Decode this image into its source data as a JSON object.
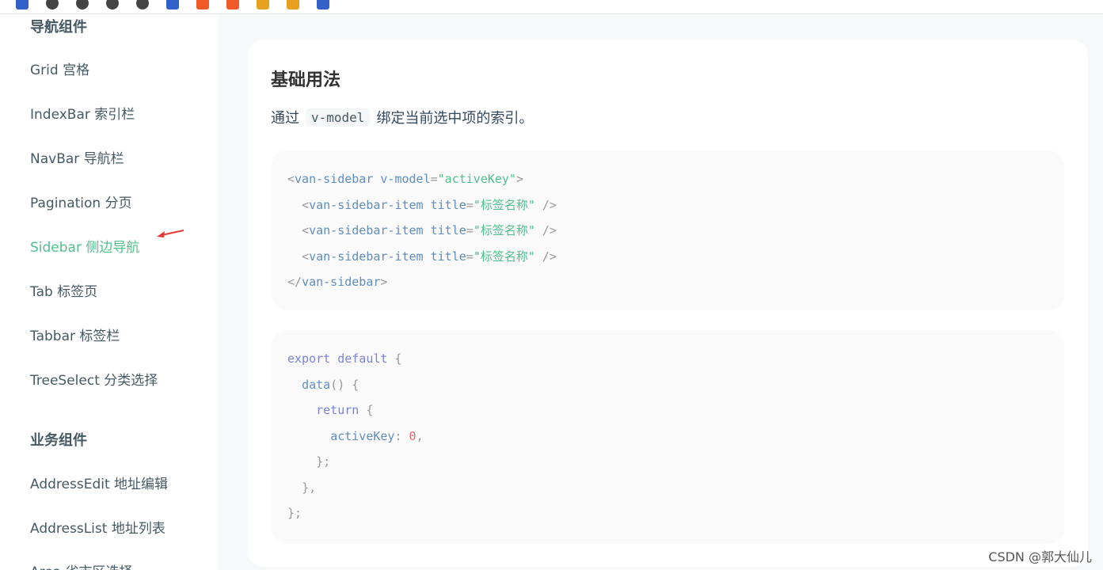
{
  "sidebar": {
    "groups": [
      {
        "title": "导航组件"
      },
      {
        "title": "业务组件"
      }
    ],
    "nav_items": [
      {
        "label": "Grid 宫格"
      },
      {
        "label": "IndexBar 索引栏"
      },
      {
        "label": "NavBar 导航栏"
      },
      {
        "label": "Pagination 分页"
      },
      {
        "label": "Sidebar 侧边导航"
      },
      {
        "label": "Tab 标签页"
      },
      {
        "label": "Tabbar 标签栏"
      },
      {
        "label": "TreeSelect 分类选择"
      },
      {
        "label": "AddressEdit 地址编辑"
      },
      {
        "label": "AddressList 地址列表"
      },
      {
        "label": "Area 省市区选择"
      }
    ],
    "active_color": "#4fc08d"
  },
  "main": {
    "title": "基础用法",
    "desc_prefix": "通过",
    "desc_code": "v-model",
    "desc_suffix": "绑定当前选中项的索引。",
    "code1": {
      "tag_open": "van-sidebar",
      "attr": "v-model",
      "attr_val": "\"activeKey\"",
      "item_tag": "van-sidebar-item",
      "item_attr": "title",
      "item_val": "\"标签名称\"",
      "tag_close": "van-sidebar"
    },
    "code2": {
      "kw_export": "export",
      "kw_default": "default",
      "fn_data": "data",
      "kw_return": "return",
      "prop_key": "activeKey",
      "prop_val": "0"
    }
  },
  "watermark": "CSDN @郭大仙儿"
}
